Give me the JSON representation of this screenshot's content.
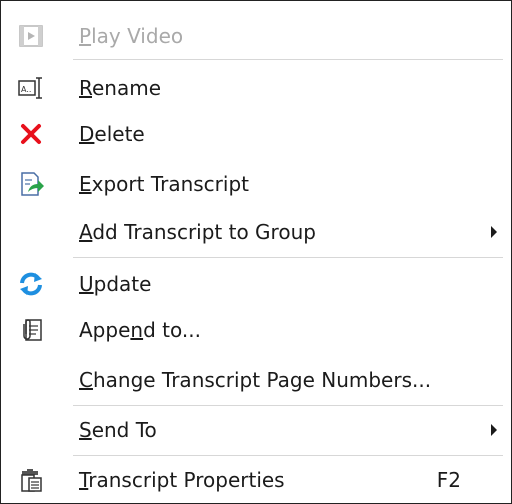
{
  "menu": {
    "items": [
      {
        "label": "Play Video",
        "mnemonic_index": 0,
        "disabled": true,
        "icon": "play-video-icon"
      },
      {
        "label": "Rename",
        "mnemonic_index": 0,
        "icon": "rename-icon"
      },
      {
        "label": "Delete",
        "mnemonic_index": 0,
        "icon": "delete-x-icon"
      },
      {
        "label": "Export Transcript",
        "mnemonic_index": 0,
        "icon": "export-icon"
      },
      {
        "label": "Add Transcript to Group",
        "mnemonic_index": 0,
        "submenu": true
      },
      {
        "label": "Update",
        "mnemonic_index": 0,
        "icon": "update-refresh-icon"
      },
      {
        "label": "Append to...",
        "mnemonic_index": 4,
        "icon": "append-icon"
      },
      {
        "label": "Change Transcript Page Numbers...",
        "mnemonic_index": 0
      },
      {
        "label": "Send To",
        "mnemonic_index": 0,
        "submenu": true
      },
      {
        "label": "Transcript Properties",
        "mnemonic_index": 0,
        "shortcut": "F2",
        "icon": "properties-icon"
      }
    ]
  },
  "colors": {
    "disabled_text": "#a9a9a9",
    "text": "#1b1b1b",
    "separator": "#d7d7d7",
    "delete_red": "#e8101c",
    "update_blue": "#1e8fe0",
    "export_green": "#2aa34a"
  }
}
